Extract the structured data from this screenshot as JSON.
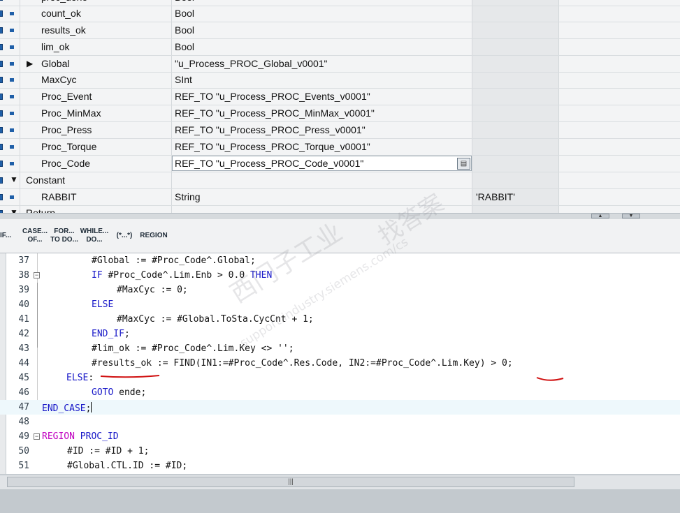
{
  "variables": [
    {
      "name": "proc_done",
      "type": "Bool",
      "value": ""
    },
    {
      "name": "count_ok",
      "type": "Bool",
      "value": ""
    },
    {
      "name": "results_ok",
      "type": "Bool",
      "value": ""
    },
    {
      "name": "lim_ok",
      "type": "Bool",
      "value": ""
    },
    {
      "name": "Global",
      "type": "\"u_Process_PROC_Global_v0001\"",
      "value": ""
    },
    {
      "name": "MaxCyc",
      "type": "SInt",
      "value": ""
    },
    {
      "name": "Proc_Event",
      "type": "REF_TO \"u_Process_PROC_Events_v0001\"",
      "value": ""
    },
    {
      "name": "Proc_MinMax",
      "type": "REF_TO \"u_Process_PROC_MinMax_v0001\"",
      "value": ""
    },
    {
      "name": "Proc_Press",
      "type": "REF_TO \"u_Process_PROC_Press_v0001\"",
      "value": ""
    },
    {
      "name": "Proc_Torque",
      "type": "REF_TO \"u_Process_PROC_Torque_v0001\"",
      "value": ""
    },
    {
      "name": "Proc_Code",
      "type": "REF_TO \"u_Process_PROC_Code_v0001\"",
      "value": ""
    }
  ],
  "sections": {
    "constant_label": "Constant",
    "constant_row": {
      "name": "RABBIT",
      "type": "String",
      "value": "'RABBIT'"
    },
    "return_label": "Return"
  },
  "toolbar": {
    "buttons": [
      {
        "l1": "IF...",
        "l2": ""
      },
      {
        "l1": "CASE...",
        "l2": "OF..."
      },
      {
        "l1": "FOR...",
        "l2": "TO DO..."
      },
      {
        "l1": "WHILE...",
        "l2": "DO..."
      },
      {
        "l1": "(*...*)",
        "l2": ""
      },
      {
        "l1": "REGION",
        "l2": ""
      }
    ]
  },
  "code": {
    "lines": [
      {
        "n": "37",
        "t": "#Global := #Proc_Code^.Global;"
      },
      {
        "n": "38",
        "a": "IF",
        "b": " #Proc_Code^.Lim.Enb > 0.0 ",
        "c": "THEN"
      },
      {
        "n": "39",
        "t": "#MaxCyc := 0;"
      },
      {
        "n": "40",
        "a": "ELSE"
      },
      {
        "n": "41",
        "t": "#MaxCyc := #Global.ToSta.CycCnt + 1;"
      },
      {
        "n": "42",
        "a": "END_IF",
        "b": ";"
      },
      {
        "n": "43",
        "t": "#lim_ok := #Proc_Code^.Lim.Key <> '';"
      },
      {
        "n": "44",
        "t": "#results_ok := FIND(IN1:=#Proc_Code^.Res.Code, IN2:=#Proc_Code^.Lim.Key) > 0;"
      },
      {
        "n": "45",
        "a": "ELSE",
        "b": ":"
      },
      {
        "n": "46",
        "a": "GOTO",
        "b": " ende;"
      },
      {
        "n": "47",
        "a": "END_CASE",
        "b": ";"
      },
      {
        "n": "48"
      },
      {
        "n": "49",
        "a": "REGION",
        "b": " PROC_ID"
      },
      {
        "n": "50",
        "t": "#ID := #ID + 1;"
      },
      {
        "n": "51",
        "t": "#Global.CTL.ID := #ID;"
      }
    ]
  },
  "watermark": {
    "line1": "西门子工业",
    "line2": "support.industry.siemens.com/cs",
    "line3": "找答案"
  },
  "colors": {
    "keyword": "#1818c8",
    "region_keyword": "#c000c0",
    "annotation": "#d01010",
    "current_line": "#eef8fc"
  },
  "icons": {
    "expand": "triangle-right-icon",
    "collapse": "triangle-down-icon",
    "cell_button": "list-picker-icon",
    "fold": "fold-minus-icon"
  }
}
